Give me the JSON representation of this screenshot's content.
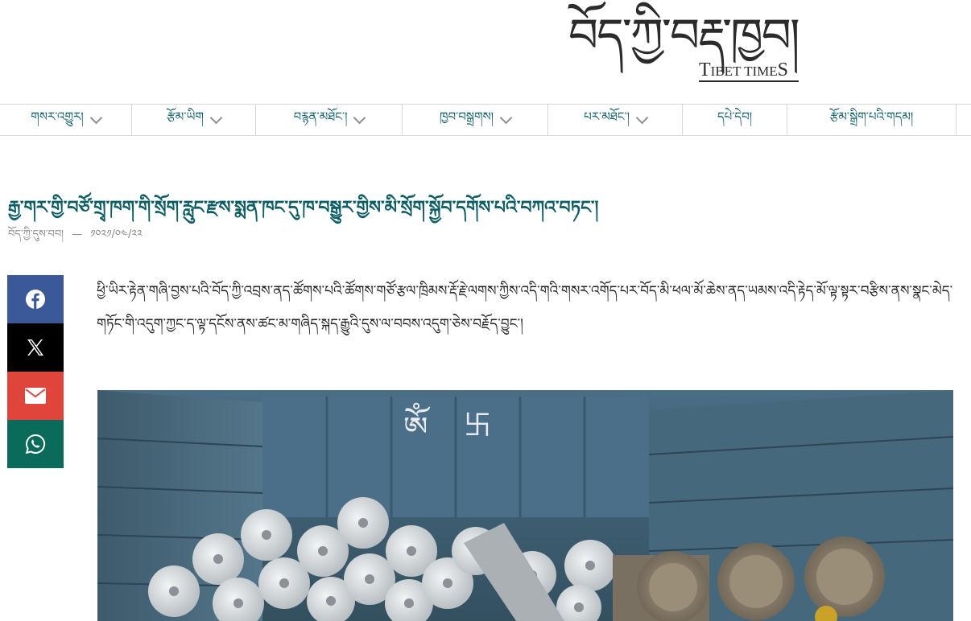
{
  "site": {
    "logo_tibetan": "བོད་ཀྱི་བརྡ་ཁྱབ།",
    "logo_english_first": "T",
    "logo_english_rest": "IBET TIME",
    "logo_english_last": "S"
  },
  "nav": {
    "items": [
      {
        "label": "གསར་འགྱུར།",
        "dropdown": true
      },
      {
        "label": "རྩོམ་ཡིག",
        "dropdown": true
      },
      {
        "label": "བརྙན་མཐོང་།",
        "dropdown": true
      },
      {
        "label": "ཁྱབ་བསྒྲགས།",
        "dropdown": true
      },
      {
        "label": "པར་མཐོང་།",
        "dropdown": true
      },
      {
        "label": "དཔེ་དེབ།",
        "dropdown": false
      },
      {
        "label": "རྩོམ་སྒྲིག་པའི་གདམ།",
        "dropdown": false
      }
    ]
  },
  "article": {
    "title": "རྒྱ་གར་གྱི་བཙོ་གྲྭ་ཁག་གི་སྲོག་རླུང་རྫས་སྨན་ཁང་དུ་ཁ་བསྒྱུར་གྱིས་མི་སྲོག་སྐྱོབ་དགོས་པའི་བཀའ་བཏང་།",
    "source": "བོད་ཀྱི་དུས་བབ།",
    "separator": "—",
    "date": "༡༠༢༡/༠༤/༢༢",
    "paragraph": "ཕྱི་ཡིར་རྟེན་གཞི་བྱས་པའི་བོད་ཀྱི་འབྲས་ནད་ཚོགས་པའི་ཚོགས་གཙོ་རྩལ་ཁྲིམས་རྡོ་རྗེ་ལགས་ཀྱིས་འདི་གའི་གསར་འགོད་པར་བོད་མི་ཕལ་མོ་ཆེས་ནད་ཡམས་འདི་རྟེད་མོ་ལྟ་སྟར་བརྩིས་ནས་སྣང་མེད་གཏོང་གི་འདུག་ཀྱང་ད་ལྟ་དངོས་ནས་ཚང་མ་གཞིད་སྐད་རྒྱུའི་དུས་ལ་བབས་འདུག་ཅེས་བརྗོད་བྱུང་།"
  },
  "share": {
    "items": [
      {
        "name": "facebook",
        "color": "#3b5998"
      },
      {
        "name": "x",
        "color": "#000000"
      },
      {
        "name": "email",
        "color": "#e0453c"
      },
      {
        "name": "whatsapp",
        "color": "#0b6b5a"
      }
    ]
  },
  "image": {
    "wall_text": "ཨོཾ"
  },
  "colors": {
    "accent": "#0d5f66",
    "meta": "#8a8a8a"
  }
}
